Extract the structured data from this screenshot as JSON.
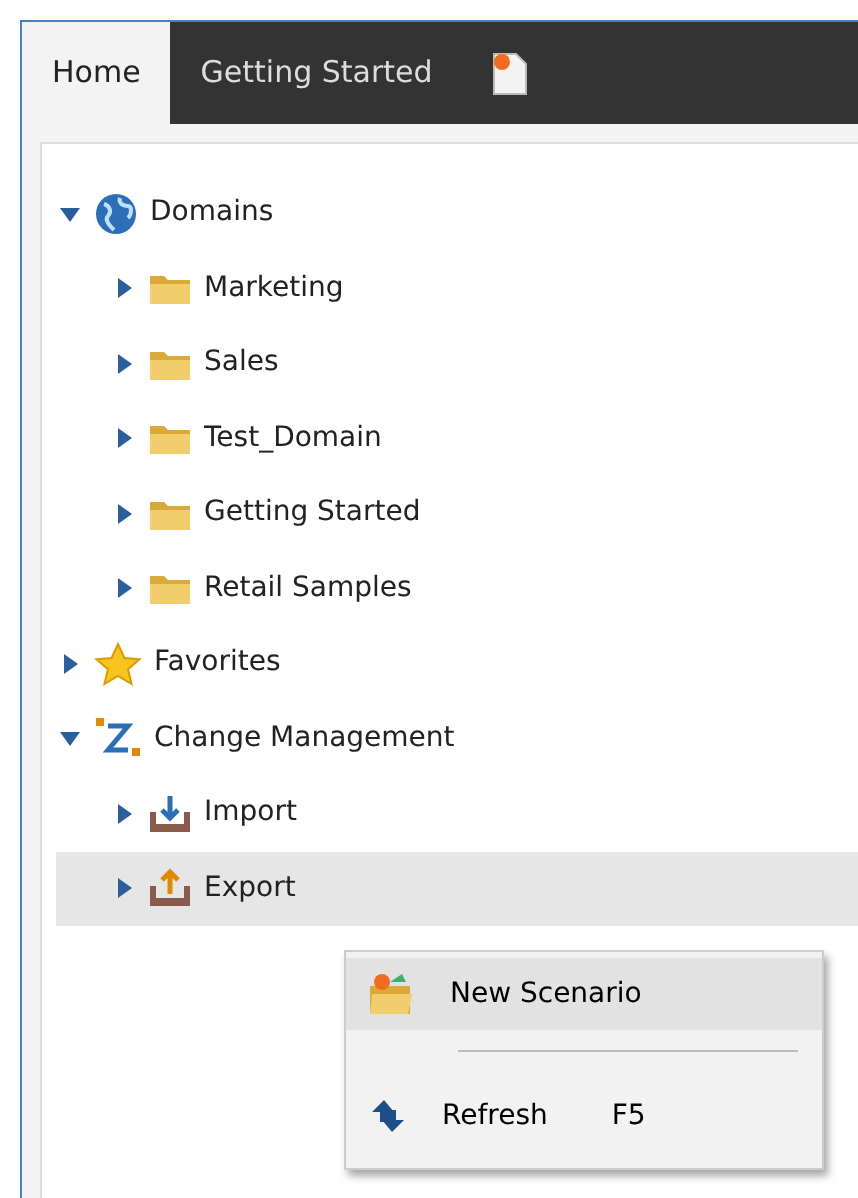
{
  "tabs": [
    {
      "kind": "text",
      "label": "Home",
      "selected": true
    },
    {
      "kind": "text",
      "label": "Getting Started",
      "selected": false
    },
    {
      "kind": "new-icon",
      "selected": false
    }
  ],
  "tree": [
    {
      "label": "Domains",
      "kind": "globe",
      "expanded": true,
      "selected": false,
      "children": [
        {
          "label": "Marketing",
          "kind": "folder",
          "expanded": false,
          "selected": false
        },
        {
          "label": "Sales",
          "kind": "folder",
          "expanded": false,
          "selected": false
        },
        {
          "label": "Test_Domain",
          "kind": "folder",
          "expanded": false,
          "selected": false
        },
        {
          "label": "Getting Started",
          "kind": "folder",
          "expanded": false,
          "selected": false
        },
        {
          "label": "Retail Samples",
          "kind": "folder",
          "expanded": false,
          "selected": false
        }
      ]
    },
    {
      "label": "Favorites",
      "kind": "star",
      "expanded": false,
      "selected": false
    },
    {
      "label": "Change Management",
      "kind": "change",
      "expanded": true,
      "selected": false,
      "children": [
        {
          "label": "Import",
          "kind": "import",
          "expanded": false,
          "selected": false
        },
        {
          "label": "Export",
          "kind": "export",
          "expanded": false,
          "selected": true
        }
      ]
    }
  ],
  "context_menu": [
    {
      "kind": "scenario",
      "label": "New Scenario",
      "selected": true
    },
    {
      "kind": "separator"
    },
    {
      "kind": "refresh",
      "label": "Refresh",
      "shortcut": "F5",
      "selected": false
    }
  ]
}
